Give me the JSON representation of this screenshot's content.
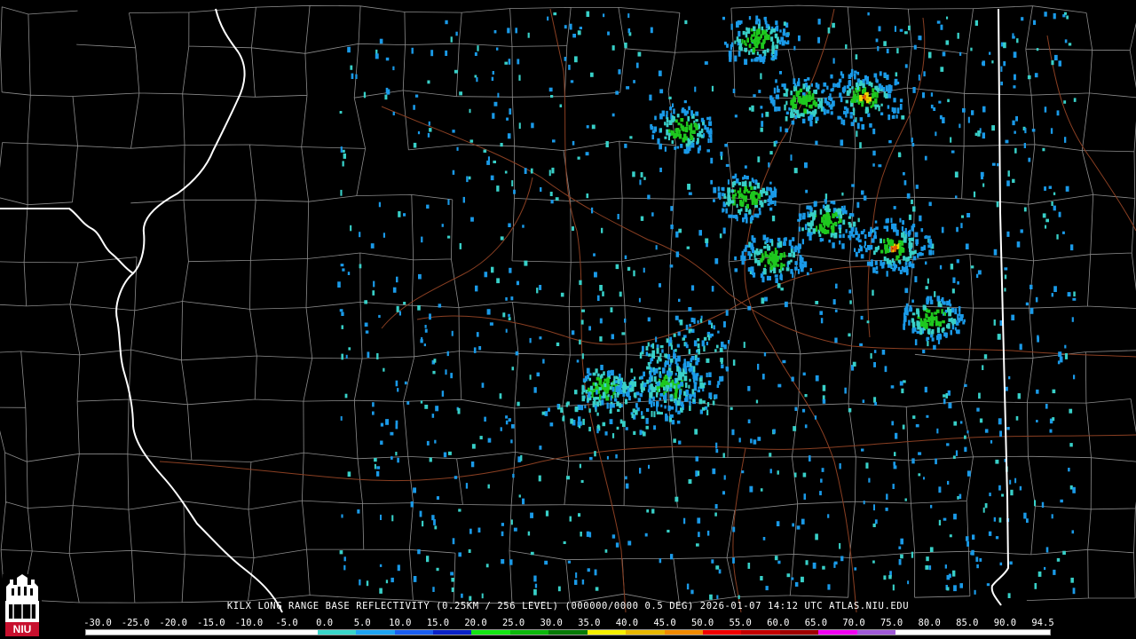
{
  "product_caption": "KILX LONG RANGE BASE REFLECTIVITY (0.25KM / 256 LEVEL) (000000/0000 0.5 DEG) 2026-01-07 14:12 UTC  ATLAS.NIU.EDU",
  "logo_text": "NIU",
  "legend": {
    "labels": [
      "-30.0",
      "-25.0",
      "-20.0",
      "-15.0",
      "-10.0",
      "-5.0",
      "0.0",
      "5.0",
      "10.0",
      "15.0",
      "20.0",
      "25.0",
      "30.0",
      "35.0",
      "40.0",
      "45.0",
      "50.0",
      "55.0",
      "60.0",
      "65.0",
      "70.0",
      "75.0",
      "80.0",
      "85.0",
      "90.0",
      "94.5"
    ],
    "colors": [
      "#ffffff",
      "#ffffff",
      "#ffffff",
      "#ffffff",
      "#ffffff",
      "#ffffff",
      "#39d6c9",
      "#1ea4f2",
      "#1a5ef0",
      "#0a22c8",
      "#14e614",
      "#0cb80c",
      "#067a06",
      "#f6f000",
      "#e8b800",
      "#f08a00",
      "#f00000",
      "#c40000",
      "#a00000",
      "#f000f0",
      "#a05ad8",
      "#ffffff",
      "#ffffff",
      "#ffffff",
      "#ffffff"
    ]
  },
  "colors": {
    "background": "#000000",
    "county_lines": "#8c8c8c",
    "state_lines": "#ffffff",
    "roads": "#8a3f22",
    "echo_weak": "#1a9ae8",
    "echo_light": "#38d0c8",
    "echo_moderate": "#1ec81e",
    "echo_strong": "#e8d800",
    "echo_heavy": "#e85a00"
  },
  "map": {
    "radar_site": "KILX",
    "echo_clusters": [
      {
        "lon_frac": 0.665,
        "lat_frac": 0.06,
        "strength": 2
      },
      {
        "lon_frac": 0.705,
        "lat_frac": 0.155,
        "strength": 2
      },
      {
        "lon_frac": 0.76,
        "lat_frac": 0.15,
        "strength": 3
      },
      {
        "lon_frac": 0.6,
        "lat_frac": 0.2,
        "strength": 2
      },
      {
        "lon_frac": 0.655,
        "lat_frac": 0.305,
        "strength": 2
      },
      {
        "lon_frac": 0.728,
        "lat_frac": 0.345,
        "strength": 2
      },
      {
        "lon_frac": 0.786,
        "lat_frac": 0.385,
        "strength": 3
      },
      {
        "lon_frac": 0.68,
        "lat_frac": 0.4,
        "strength": 2
      },
      {
        "lon_frac": 0.82,
        "lat_frac": 0.495,
        "strength": 2
      },
      {
        "lon_frac": 0.59,
        "lat_frac": 0.6,
        "strength": 2
      },
      {
        "lon_frac": 0.53,
        "lat_frac": 0.605,
        "strength": 1
      }
    ]
  }
}
